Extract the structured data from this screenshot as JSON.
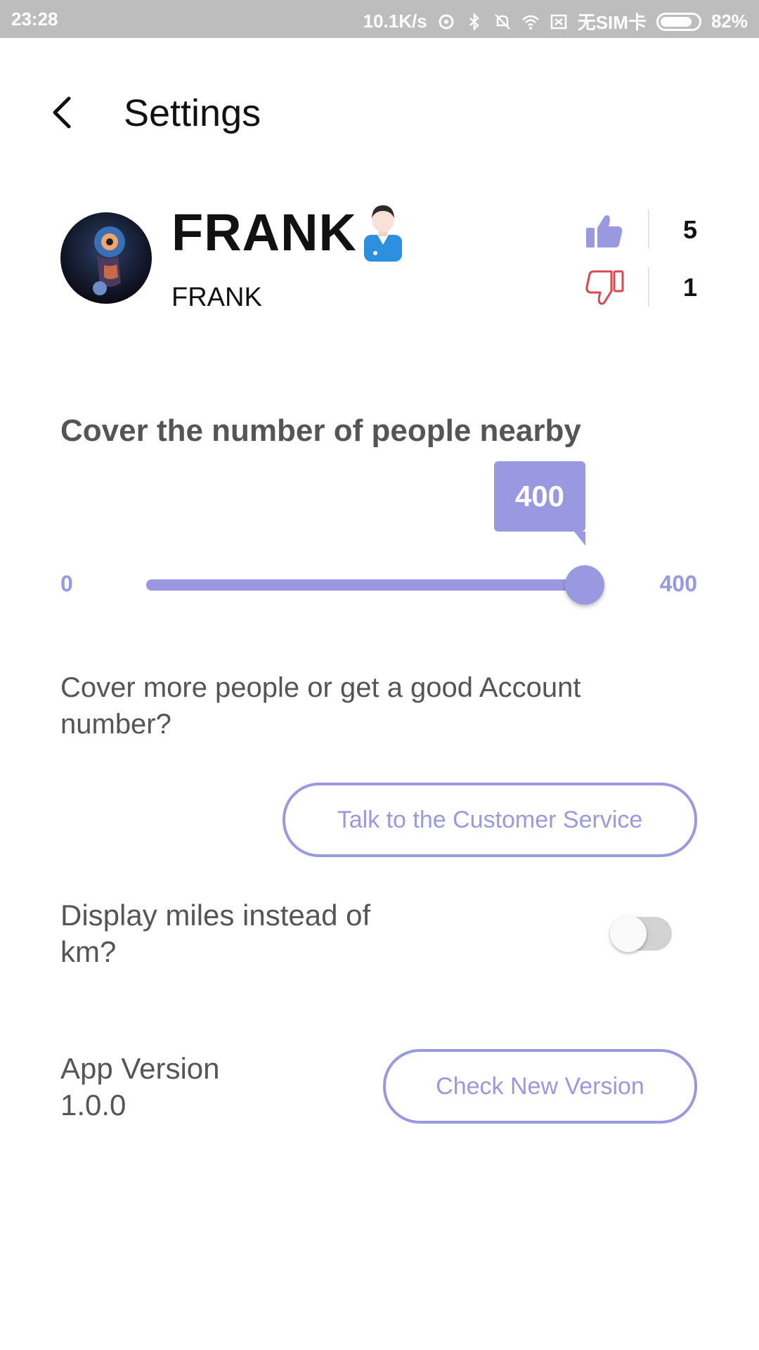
{
  "status_bar": {
    "time": "23:28",
    "network_speed": "10.1K/s",
    "sim": "无SIM卡",
    "battery": "82%"
  },
  "header": {
    "title": "Settings",
    "back_icon": "chevron-left-icon"
  },
  "profile": {
    "display_name": "FRANK",
    "username": "FRANK",
    "gender_icon": "male-person-icon",
    "likes": "5",
    "dislikes": "1",
    "colors": {
      "like": "#9899e0",
      "dislike": "#e0474c"
    }
  },
  "coverage": {
    "title": "Cover the number of people nearby",
    "min_label": "0",
    "max_label": "400",
    "min": 0,
    "max": 400,
    "value": 400,
    "value_label": "400"
  },
  "support": {
    "question": "Cover more people or get a good Account number?",
    "button_label": "Talk to the Customer Service"
  },
  "units": {
    "label": "Display miles instead of km?",
    "enabled": false
  },
  "version": {
    "label": "App Version 1.0.0",
    "button_label": "Check New Version"
  },
  "theme": {
    "accent": "#9899e0",
    "text_secondary": "#555555"
  }
}
